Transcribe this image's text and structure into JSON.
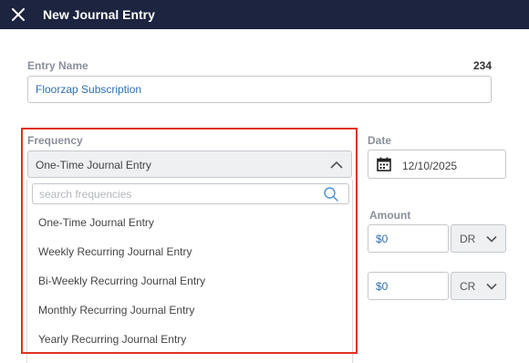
{
  "header": {
    "title": "New Journal Entry",
    "close_icon": "close-icon"
  },
  "entry": {
    "label": "Entry Name",
    "count": "234",
    "value": "Floorzap Subscription"
  },
  "frequency": {
    "label": "Frequency",
    "selected": "One-Time Journal Entry",
    "search_placeholder": "search frequencies",
    "options": [
      "One-Time Journal Entry",
      "Weekly Recurring Journal Entry",
      "Bi-Weekly Recurring Journal Entry",
      "Monthly Recurring Journal Entry",
      "Yearly Recurring Journal Entry"
    ]
  },
  "date": {
    "label": "Date",
    "value": "12/10/2025",
    "icon": "calendar-icon"
  },
  "amount": {
    "label": "Amount",
    "rows": [
      {
        "value": "$0",
        "side": "DR"
      },
      {
        "value": "$0",
        "side": "CR"
      }
    ]
  },
  "colors": {
    "header_bg": "#1d2440",
    "highlight": "#e0301e",
    "link_text": "#2f6fb0"
  }
}
